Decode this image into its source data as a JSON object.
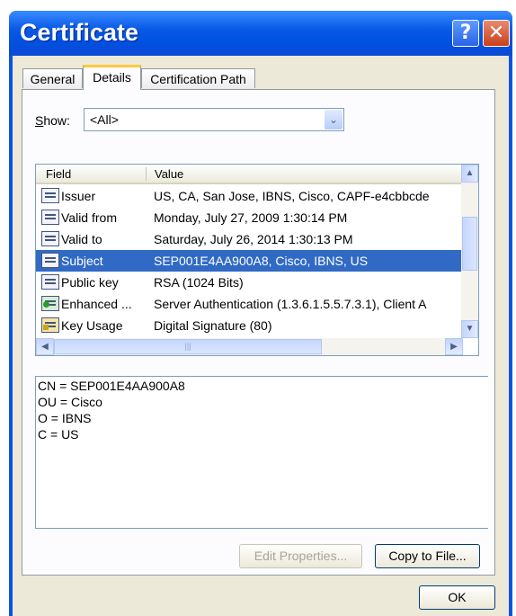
{
  "window": {
    "title": "Certificate",
    "help_glyph": "?",
    "close_glyph": "✕"
  },
  "tabs": [
    {
      "label": "General"
    },
    {
      "label": "Details"
    },
    {
      "label": "Certification Path"
    }
  ],
  "show": {
    "label_prefix": "S",
    "label_rest": "how:",
    "selected": "<All>",
    "arrow": "⌄"
  },
  "list": {
    "col_field": "Field",
    "col_value": "Value",
    "rows": [
      {
        "field": "Issuer",
        "value": "US, CA, San Jose, IBNS, Cisco, CAPF-e4cbbcde",
        "icon": "certificate-field-icon"
      },
      {
        "field": "Valid from",
        "value": "Monday, July 27, 2009 1:30:14 PM",
        "icon": "certificate-field-icon"
      },
      {
        "field": "Valid to",
        "value": "Saturday, July 26, 2014 1:30:13 PM",
        "icon": "certificate-field-icon"
      },
      {
        "field": "Subject",
        "value": "SEP001E4AA900A8, Cisco, IBNS, US",
        "icon": "certificate-field-icon",
        "selected": true
      },
      {
        "field": "Public key",
        "value": "RSA (1024 Bits)",
        "icon": "certificate-field-icon"
      },
      {
        "field": "Enhanced ...",
        "value": "Server Authentication (1.3.6.1.5.5.7.3.1), Client A",
        "icon": "certificate-extension-icon"
      },
      {
        "field": "Key Usage",
        "value": "Digital Signature (80)",
        "icon": "key-usage-icon"
      }
    ]
  },
  "detail_lines": [
    "CN = SEP001E4AA900A8",
    "OU = Cisco",
    "O = IBNS",
    "C = US"
  ],
  "buttons": {
    "edit_properties": "Edit Properties...",
    "copy_to_file": "Copy to File...",
    "ok": "OK"
  },
  "colors": {
    "titlebar": "#0a54e3",
    "selection": "#316ac5",
    "dialog_bg": "#ece9d8",
    "tab_accent": "#ffc83c"
  }
}
